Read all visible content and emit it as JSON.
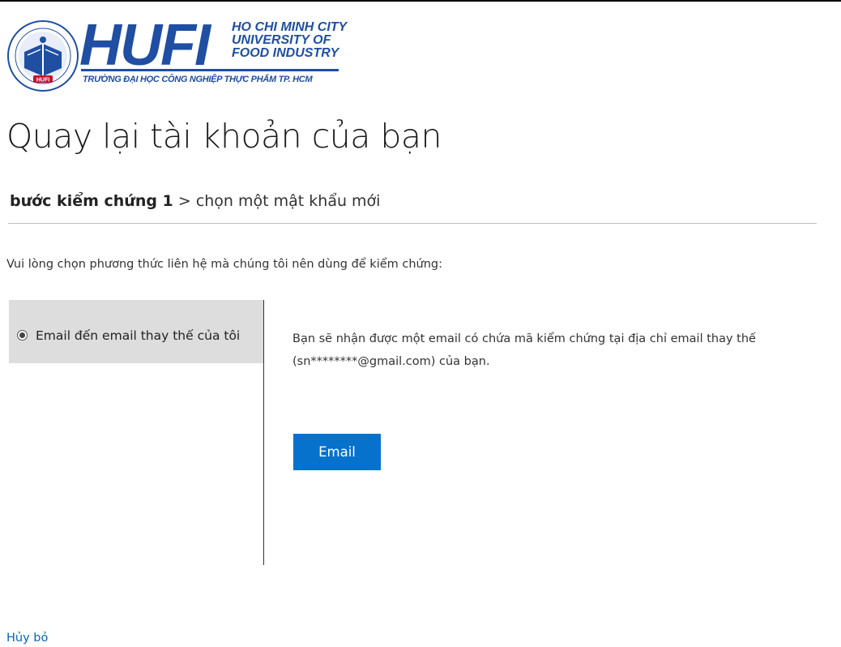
{
  "logo": {
    "brand": "HUFI",
    "subtitle_lines": [
      "HO CHI MINH CITY",
      "UNIVERSITY OF",
      "FOOD INDUSTRY"
    ],
    "vietnamese_name": "TRƯỜNG ĐẠI HỌC CÔNG NGHIỆP THỰC PHẨM TP. HCM",
    "seal_text": "HUFI",
    "brand_color": "#1f4ea3"
  },
  "page": {
    "title": "Quay lại tài khoản của bạn",
    "breadcrumb": {
      "current_step": "bước kiểm chứng 1",
      "separator": ">",
      "next_step": "chọn một mật khẩu mới"
    },
    "prompt": "Vui lòng chọn phương thức liên hệ mà chúng tôi nên dùng để kiểm chứng:"
  },
  "options": [
    {
      "label": "Email đến email thay thế của tôi",
      "selected": true
    }
  ],
  "detail": {
    "line1": "Bạn sẽ nhận được một email có chứa mã kiểm chứng tại địa chỉ email thay thế",
    "line2": "(sn********@gmail.com) của bạn.",
    "button_label": "Email"
  },
  "footer": {
    "cancel_label": "Hủy bỏ"
  },
  "colors": {
    "accent_button": "#0672cb",
    "link": "#0067b8",
    "option_selected_bg": "#dddddd"
  }
}
